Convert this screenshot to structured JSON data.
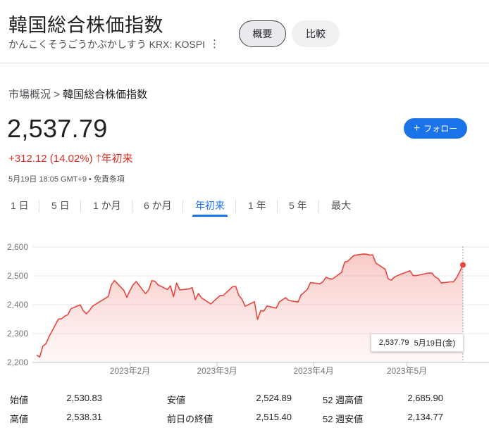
{
  "header": {
    "title": "韓国総合株価指数",
    "subtitle": "かんこくそうごうかぶかしすう KRX: KOSPI",
    "more_icon": "vertical-dots-icon",
    "tabs": [
      "概要",
      "比較"
    ]
  },
  "breadcrumb": {
    "parent": "市場概況",
    "separator": ">",
    "current": "韓国総合株価指数"
  },
  "quote": {
    "price": "2,537.79",
    "change": "+312.12 (14.02%)",
    "change_icon": "arrow-up-icon",
    "period": "年初来",
    "timestamp": "5月19日 18:05 GMT+9 • 免責条項"
  },
  "follow_button": {
    "icon": "plus-icon",
    "label": "フォロー"
  },
  "ranges": [
    "1 日",
    "5 日",
    "1 か月",
    "6 か月",
    "年初来",
    "1 年",
    "5 年",
    "最大"
  ],
  "active_range": "年初来",
  "colors": {
    "accent": "#1a73e8",
    "down_up_red": "#d93025",
    "line": "#e8453c"
  },
  "chart_data": {
    "type": "area",
    "x": [
      "2023-01-02",
      "2023-01-03",
      "2023-01-04",
      "2023-01-05",
      "2023-01-06",
      "2023-01-09",
      "2023-01-10",
      "2023-01-11",
      "2023-01-12",
      "2023-01-13",
      "2023-01-16",
      "2023-01-17",
      "2023-01-18",
      "2023-01-19",
      "2023-01-20",
      "2023-01-25",
      "2023-01-26",
      "2023-01-27",
      "2023-01-30",
      "2023-01-31",
      "2023-02-01",
      "2023-02-02",
      "2023-02-03",
      "2023-02-06",
      "2023-02-07",
      "2023-02-08",
      "2023-02-09",
      "2023-02-10",
      "2023-02-13",
      "2023-02-14",
      "2023-02-15",
      "2023-02-16",
      "2023-02-17",
      "2023-02-20",
      "2023-02-21",
      "2023-02-22",
      "2023-02-23",
      "2023-02-24",
      "2023-02-27",
      "2023-02-28",
      "2023-03-02",
      "2023-03-03",
      "2023-03-06",
      "2023-03-07",
      "2023-03-08",
      "2023-03-09",
      "2023-03-10",
      "2023-03-13",
      "2023-03-14",
      "2023-03-15",
      "2023-03-16",
      "2023-03-17",
      "2023-03-20",
      "2023-03-21",
      "2023-03-22",
      "2023-03-23",
      "2023-03-24",
      "2023-03-27",
      "2023-03-28",
      "2023-03-29",
      "2023-03-30",
      "2023-03-31",
      "2023-04-03",
      "2023-04-04",
      "2023-04-05",
      "2023-04-06",
      "2023-04-07",
      "2023-04-10",
      "2023-04-11",
      "2023-04-12",
      "2023-04-13",
      "2023-04-14",
      "2023-04-17",
      "2023-04-18",
      "2023-04-19",
      "2023-04-20",
      "2023-04-21",
      "2023-04-24",
      "2023-04-25",
      "2023-04-26",
      "2023-04-27",
      "2023-04-28",
      "2023-05-02",
      "2023-05-03",
      "2023-05-04",
      "2023-05-08",
      "2023-05-09",
      "2023-05-10",
      "2023-05-11",
      "2023-05-12",
      "2023-05-15",
      "2023-05-16",
      "2023-05-17",
      "2023-05-18",
      "2023-05-19"
    ],
    "series": [
      {
        "values": [
          2225.67,
          2218.68,
          2255.98,
          2264.65,
          2289.97,
          2350.19,
          2351.31,
          2359.88,
          2365.1,
          2386.09,
          2399.86,
          2379.39,
          2368.32,
          2380.34,
          2395.26,
          2428.57,
          2468.65,
          2484.02,
          2450.47,
          2425.08,
          2449.8,
          2468.88,
          2480.4,
          2438.19,
          2451.21,
          2483.64,
          2481.52,
          2469.07,
          2452.7,
          2465.64,
          2427.9,
          2475.48,
          2451.21,
          2455.12,
          2458.96,
          2417.68,
          2439.02,
          2423.61,
          2402.64,
          2412.85,
          2432.07,
          2432.36,
          2462.62,
          2463.35,
          2431.91,
          2419.09,
          2394.59,
          2410.6,
          2348.97,
          2379.72,
          2377.91,
          2395.69,
          2388.35,
          2410.1,
          2416.96,
          2424.48,
          2414.96,
          2409.22,
          2434.18,
          2443.38,
          2453.16,
          2476.86,
          2472.34,
          2479.82,
          2495.07,
          2490.41,
          2488.87,
          2512.08,
          2547.86,
          2550.64,
          2561.22,
          2571.02,
          2575.91,
          2575.08,
          2571.91,
          2572.93,
          2544.4,
          2523.5,
          2489.48,
          2484.83,
          2495.81,
          2501.53,
          2517.48,
          2500.94,
          2500.94,
          2510.06,
          2510.04,
          2496.81,
          2491.0,
          2475.42,
          2479.35,
          2479.64,
          2494.66,
          2515.4,
          2537.79
        ]
      }
    ],
    "x_tick_labels": [
      "2023年2月",
      "2023年3月",
      "2023年4月",
      "2023年5月"
    ],
    "y_ticks": [
      "2,600",
      "2,500",
      "2,400",
      "2,300",
      "2,200"
    ],
    "ylim": [
      2200,
      2600
    ],
    "grid": true,
    "tooltip": {
      "value": "2,537.79",
      "date": "5月19日(金)"
    }
  },
  "stats": [
    [
      {
        "label": "始値",
        "value": "2,530.83"
      },
      {
        "label": "安値",
        "value": "2,524.89"
      },
      {
        "label": "52 週高値",
        "value": "2,685.90"
      }
    ],
    [
      {
        "label": "高値",
        "value": "2,538.31"
      },
      {
        "label": "前日の終値",
        "value": "2,515.40"
      },
      {
        "label": "52 週安値",
        "value": "2,134.77"
      }
    ]
  ]
}
